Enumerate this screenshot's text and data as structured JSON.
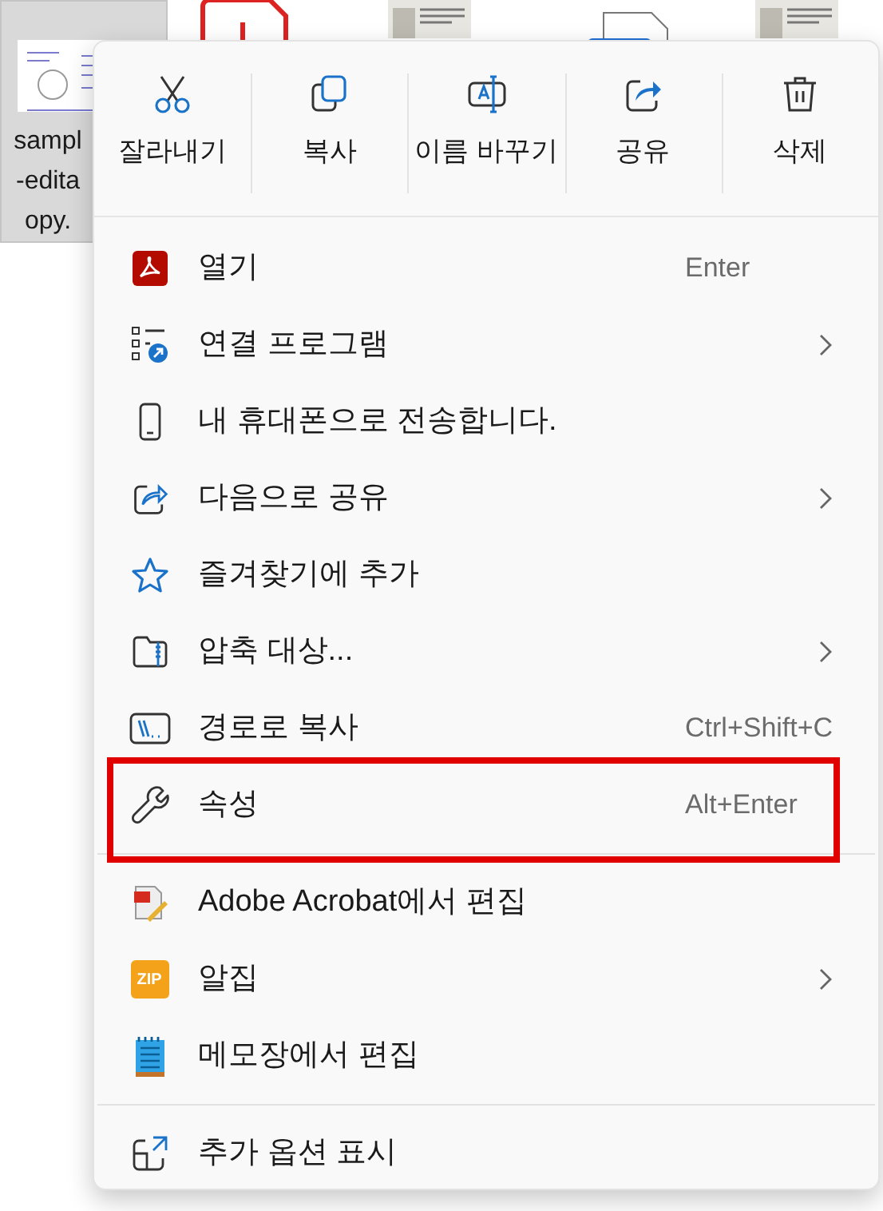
{
  "files": [
    {
      "kind": "document",
      "selected": true,
      "name_lines": [
        "sampl",
        "-edita",
        "opy."
      ]
    },
    {
      "kind": "pdf",
      "selected": false
    },
    {
      "kind": "newspaper",
      "selected": false
    },
    {
      "kind": "blank",
      "selected": false
    },
    {
      "kind": "newspaper",
      "selected": false
    }
  ],
  "toolbar": [
    {
      "label": "잘라내기"
    },
    {
      "label": "복사"
    },
    {
      "label": "이름 바꾸기"
    },
    {
      "label": "공유"
    },
    {
      "label": "삭제"
    }
  ],
  "menu": [
    {
      "kind": "item",
      "label": "열기",
      "shortcut": "Enter",
      "submenu": false,
      "outlined": false
    },
    {
      "kind": "item",
      "label": "연결 프로그램",
      "submenu": true,
      "outlined": false
    },
    {
      "kind": "item",
      "label": "내 휴대폰으로 전송합니다.",
      "submenu": false,
      "outlined": false
    },
    {
      "kind": "item",
      "label": "다음으로 공유",
      "submenu": true,
      "outlined": false
    },
    {
      "kind": "item",
      "label": "즐겨찾기에 추가",
      "submenu": false,
      "outlined": false
    },
    {
      "kind": "item",
      "label": "압축 대상...",
      "submenu": true,
      "outlined": false
    },
    {
      "kind": "item",
      "label": "경로로 복사",
      "shortcut": "Ctrl+Shift+C",
      "submenu": false,
      "outlined": false
    },
    {
      "kind": "item",
      "label": "속성",
      "shortcut": "Alt+Enter",
      "submenu": false,
      "outlined": true
    },
    {
      "kind": "separator"
    },
    {
      "kind": "item",
      "label": "Adobe Acrobat에서 편집",
      "submenu": false,
      "outlined": false
    },
    {
      "kind": "item",
      "label": "알집",
      "badge": "ZIP",
      "submenu": true,
      "outlined": false
    },
    {
      "kind": "item",
      "label": "메모장에서 편집",
      "submenu": false,
      "outlined": false
    },
    {
      "kind": "separator"
    },
    {
      "kind": "item",
      "label": "추가 옵션 표시",
      "submenu": false,
      "outlined": false
    }
  ]
}
